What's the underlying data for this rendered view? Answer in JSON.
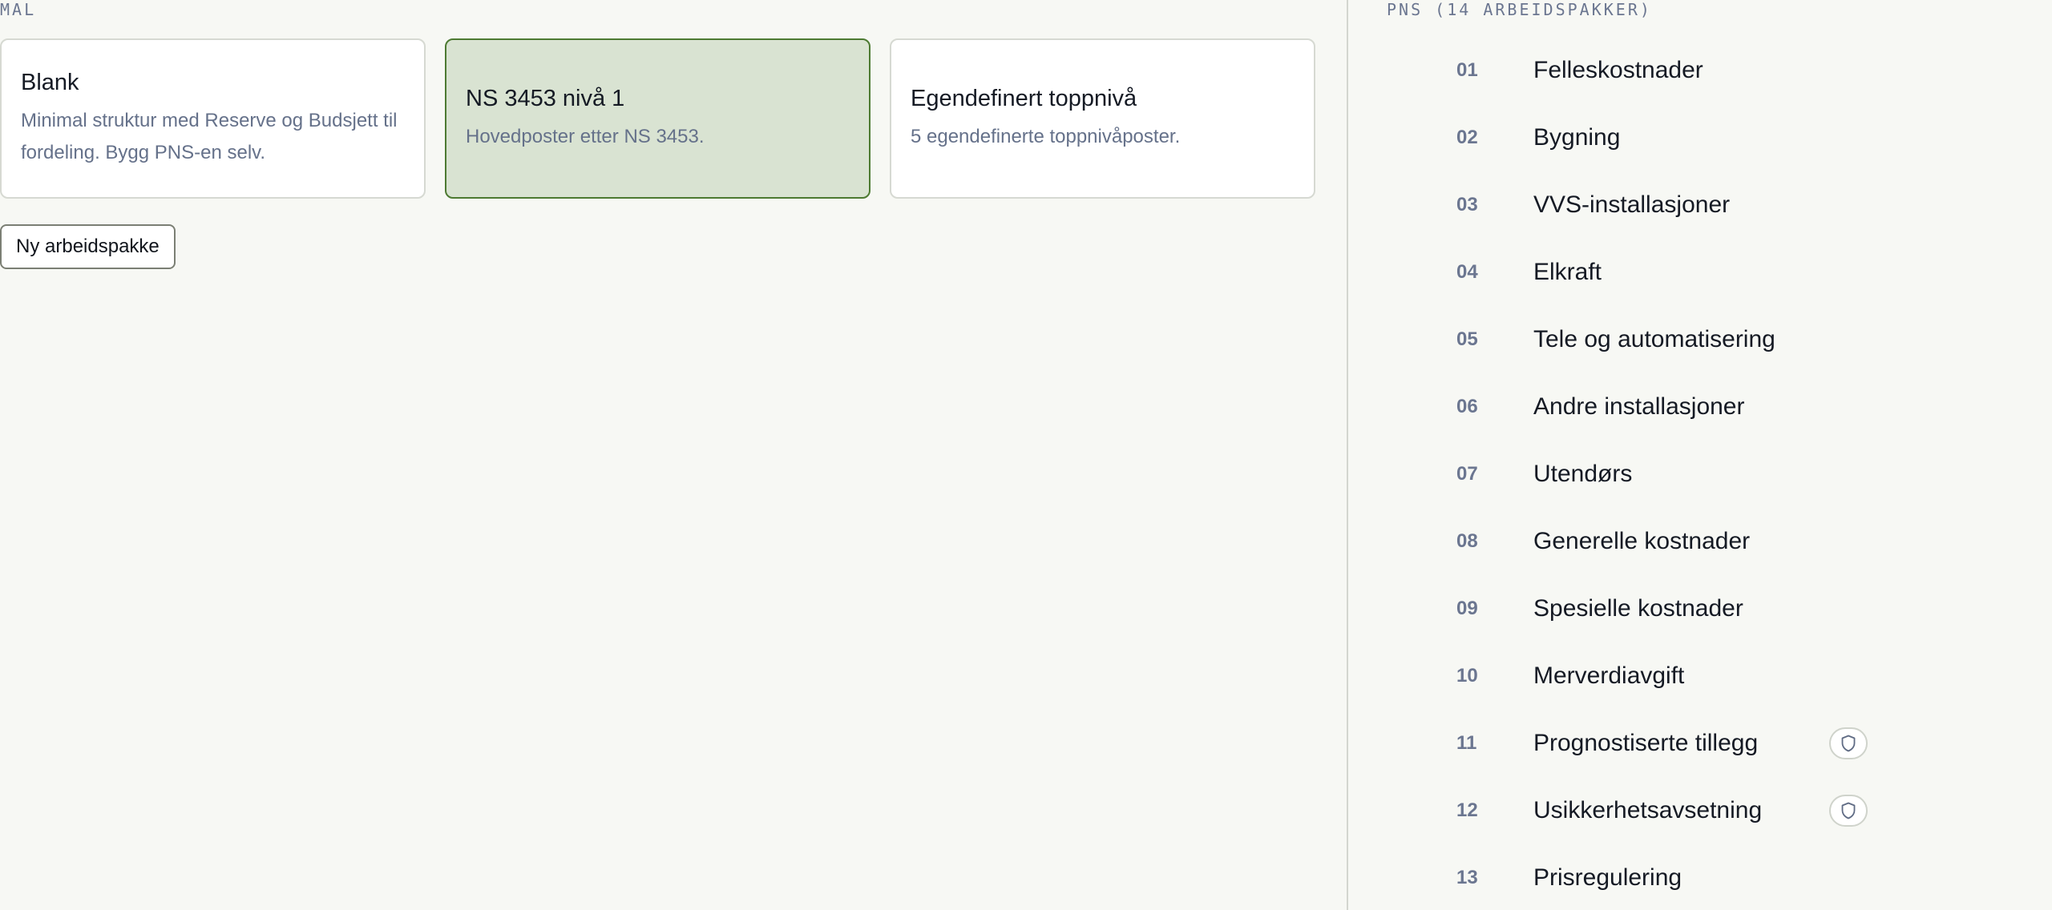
{
  "templates": {
    "label": "MAL",
    "cards": [
      {
        "title": "Blank",
        "desc": "Minimal struktur med Reserve og Budsjett til fordeling. Bygg PNS-en selv.",
        "selected": false
      },
      {
        "title": "NS 3453 nivå 1",
        "desc": "Hovedposter etter NS 3453.",
        "selected": true
      },
      {
        "title": "Egendefinert toppnivå",
        "desc": "5 egendefinerte toppnivåposter.",
        "selected": false
      }
    ],
    "new_button": "Ny arbeidspakke"
  },
  "pns": {
    "label": "PNS (14 ARBEIDSPAKKER)",
    "items": [
      {
        "num": "01",
        "name": "Felleskostnader",
        "shield": false
      },
      {
        "num": "02",
        "name": "Bygning",
        "shield": false
      },
      {
        "num": "03",
        "name": "VVS-installasjoner",
        "shield": false
      },
      {
        "num": "04",
        "name": "Elkraft",
        "shield": false
      },
      {
        "num": "05",
        "name": "Tele og automatisering",
        "shield": false
      },
      {
        "num": "06",
        "name": "Andre installasjoner",
        "shield": false
      },
      {
        "num": "07",
        "name": "Utendørs",
        "shield": false
      },
      {
        "num": "08",
        "name": "Generelle kostnader",
        "shield": false
      },
      {
        "num": "09",
        "name": "Spesielle kostnader",
        "shield": false
      },
      {
        "num": "10",
        "name": "Merverdiavgift",
        "shield": false
      },
      {
        "num": "11",
        "name": "Prognostiserte tillegg",
        "shield": true
      },
      {
        "num": "12",
        "name": "Usikkerhetsavsetning",
        "shield": true
      },
      {
        "num": "13",
        "name": "Prisregulering",
        "shield": false
      }
    ]
  },
  "icons": {
    "badge": "shield-icon"
  },
  "colors": {
    "selected_bg": "#d9e3d2",
    "selected_border": "#4d7a32",
    "muted_text": "#6b7690"
  }
}
